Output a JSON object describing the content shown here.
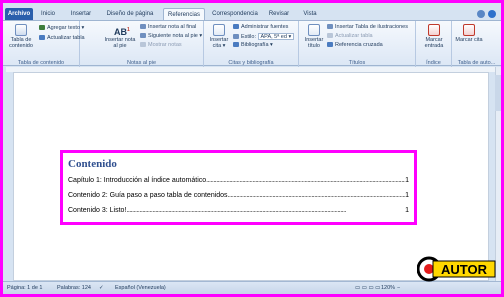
{
  "tabs": [
    {
      "label": "Archivo"
    },
    {
      "label": "Inicio"
    },
    {
      "label": "Insertar"
    },
    {
      "label": "Diseño de página"
    },
    {
      "label": "Referencias"
    },
    {
      "label": "Correspondencia"
    },
    {
      "label": "Revisar"
    },
    {
      "label": "Vista"
    }
  ],
  "ribbon": {
    "toc_group": {
      "table_btn": "Tabla de contenido",
      "add_text": "Agregar texto",
      "update_table": "Actualizar tabla",
      "label": "Tabla de contenido"
    },
    "footnotes_group": {
      "insert_footnote": "Insertar nota al pie",
      "ab_icon_text": "AB",
      "insert_endnote": "Insertar nota al final",
      "next_footnote": "Siguiente nota al pie",
      "show_notes": "Mostrar notas",
      "label": "Notas al pie"
    },
    "citations_group": {
      "insert_citation": "Insertar cita",
      "manage_sources": "Administrar fuentes",
      "style_label": "Estilo:",
      "style_value": "APA, 5ª ed",
      "bibliography": "Bibliografía",
      "label": "Citas y bibliografía"
    },
    "captions_group": {
      "insert_caption": "Insertar título",
      "insert_table_figures": "Insertar Tabla de ilustraciones",
      "update_table": "Actualizar tabla",
      "cross_reference": "Referencia cruzada",
      "label": "Títulos"
    },
    "index_group": {
      "mark_entry": "Marcar entrada",
      "label": "Índice"
    },
    "authorities_group": {
      "mark_citation": "Marcar cita",
      "label": "Tabla de auto..."
    }
  },
  "document": {
    "toc_title": "Contenido",
    "entries": [
      {
        "text": "Capítulo 1: Introducción al índice automático",
        "page": "1"
      },
      {
        "text": "Contenido 2: Guía paso a paso tabla de contenidos",
        "page": "1"
      },
      {
        "text": "Contenido 3: Listo!",
        "page": "1"
      }
    ]
  },
  "status": {
    "page": "Página: 1 de 1",
    "words": "Palabras: 124",
    "language": "Español (Venezuela)",
    "zoom": "120%"
  },
  "logo": {
    "text": "AUTOR"
  },
  "colors": {
    "highlight": "#ff00ff",
    "file_tab": "#2a5fac",
    "ribbon_bg": "#dce7f5"
  }
}
